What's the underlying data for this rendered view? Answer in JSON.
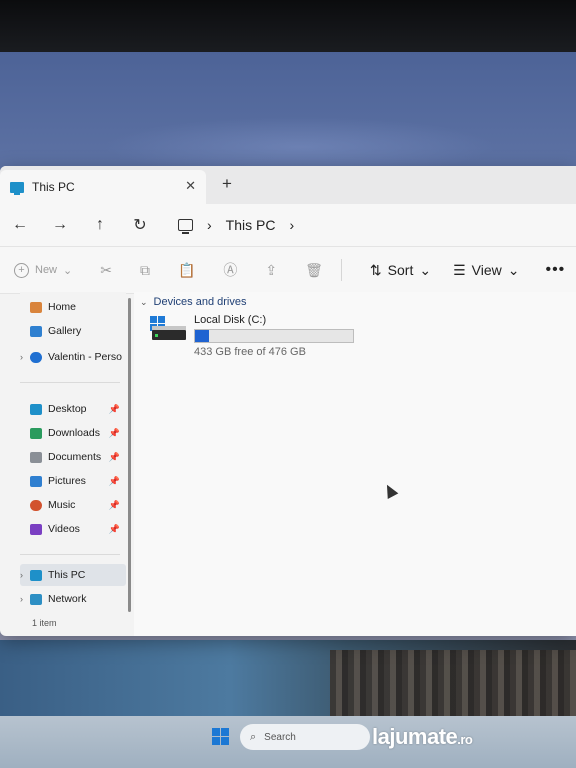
{
  "window": {
    "tab_title": "This PC",
    "close_glyph": "✕",
    "new_tab_glyph": "+"
  },
  "nav": {
    "back_glyph": "←",
    "forward_glyph": "→",
    "up_glyph": "↑",
    "refresh_glyph": "↻",
    "breadcrumb": "This PC",
    "separator": "›"
  },
  "toolbar": {
    "new_label": "New",
    "sort_label": "Sort",
    "view_label": "View",
    "more_glyph": "•••",
    "dropdown_glyph": "⌄"
  },
  "sidebar": {
    "home": "Home",
    "gallery": "Gallery",
    "onedrive": "Valentin - Perso",
    "desktop": "Desktop",
    "downloads": "Downloads",
    "documents": "Documents",
    "pictures": "Pictures",
    "music": "Music",
    "videos": "Videos",
    "this_pc": "This PC",
    "network": "Network",
    "pin_glyph": "📌",
    "expand_glyph": "›"
  },
  "content": {
    "group_header": "Devices and drives",
    "drive": {
      "name": "Local Disk (C:)",
      "free_text": "433 GB free of 476 GB",
      "used_fraction": 0.09
    }
  },
  "status": {
    "item_count": "1 item"
  },
  "taskbar": {
    "search_placeholder": "Search"
  },
  "watermark": {
    "brand": "lajumate",
    "suffix": ".ro"
  },
  "colors": {
    "accent": "#1f63d1",
    "folder_blue": "#1e90c9"
  }
}
